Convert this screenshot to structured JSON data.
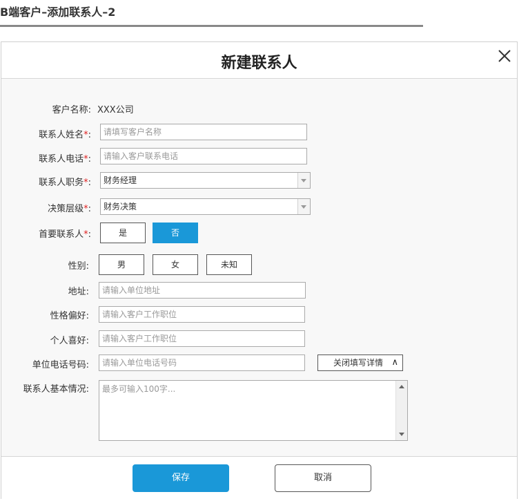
{
  "page": {
    "title": "B端客户–添加联系人–2"
  },
  "dialog": {
    "title": "新建联系人",
    "close_icon": "close-icon",
    "required_mark": "*",
    "fields": {
      "company": {
        "label": "客户名称:",
        "value": "XXX公司"
      },
      "contact_name": {
        "label": "联系人姓名",
        "colon": ":",
        "placeholder": "请填写客户名称"
      },
      "contact_phone": {
        "label": "联系人电话",
        "colon": ":",
        "placeholder": "请输入客户联系电话"
      },
      "position": {
        "label": "联系人职务",
        "colon": ":",
        "value": "财务经理"
      },
      "decision_level": {
        "label": "决策层级",
        "colon": ":",
        "value": "财务决策"
      },
      "primary_contact": {
        "label": "首要联系人",
        "colon": ":",
        "options": [
          "是",
          "否"
        ],
        "selected": "否"
      },
      "gender": {
        "label": "性别:",
        "options": [
          "男",
          "女",
          "未知"
        ]
      },
      "address": {
        "label": "地址:",
        "placeholder": "请输入单位地址"
      },
      "personality": {
        "label": "性格偏好:",
        "placeholder": "请输入客户工作职位"
      },
      "hobbies": {
        "label": "个人喜好:",
        "placeholder": "请输入客户工作职位"
      },
      "office_phone": {
        "label": "单位电话号码:",
        "placeholder": "请输入单位电话号码"
      },
      "details_toggle": {
        "label": "关闭填写详情",
        "caret": "∧"
      },
      "basic_info": {
        "label": "联系人基本情况:",
        "placeholder": "最多可输入100字..."
      }
    },
    "footer": {
      "save_label": "保存",
      "cancel_label": "取消"
    }
  }
}
